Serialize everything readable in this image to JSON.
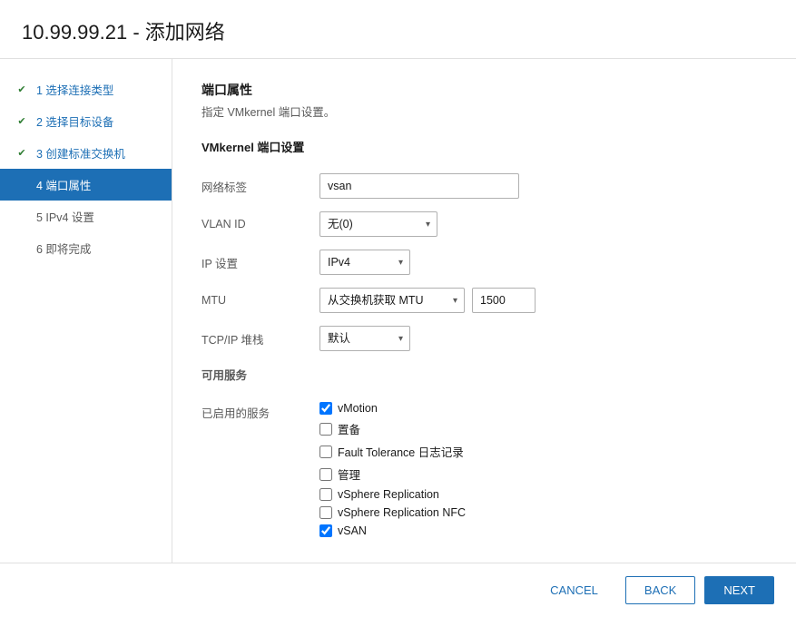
{
  "dialog": {
    "title": "10.99.99.21 - 添加网络"
  },
  "sidebar": {
    "items": [
      {
        "id": "step1",
        "label": "1 选择连接类型",
        "state": "completed"
      },
      {
        "id": "step2",
        "label": "2 选择目标设备",
        "state": "completed"
      },
      {
        "id": "step3",
        "label": "3 创建标准交换机",
        "state": "completed"
      },
      {
        "id": "step4",
        "label": "4 端口属性",
        "state": "active"
      },
      {
        "id": "step5",
        "label": "5 IPv4 设置",
        "state": "default"
      },
      {
        "id": "step6",
        "label": "6 即将完成",
        "state": "default"
      }
    ]
  },
  "main": {
    "section_title": "端口属性",
    "section_desc": "指定 VMkernel 端口设置。",
    "subsection_title": "VMkernel 端口设置",
    "fields": {
      "network_label": "网络标签",
      "network_label_value": "vsan",
      "vlan_id_label": "VLAN ID",
      "vlan_id_value": "无(0)",
      "ip_settings_label": "IP 设置",
      "ip_settings_value": "IPv4",
      "mtu_label": "MTU",
      "mtu_select_value": "从交换机获取 MTU",
      "mtu_input_value": "1500",
      "tcpip_label": "TCP/IP 堆栈",
      "tcpip_value": "默认"
    },
    "services": {
      "section_label": "可用服务",
      "enabled_label": "已启用的服务",
      "items": [
        {
          "id": "vmotion",
          "label": "vMotion",
          "checked": true
        },
        {
          "id": "provisioning",
          "label": "置备",
          "checked": false
        },
        {
          "id": "ft_logging",
          "label": "Fault Tolerance 日志记录",
          "checked": false
        },
        {
          "id": "management",
          "label": "管理",
          "checked": false
        },
        {
          "id": "vsphere_replication",
          "label": "vSphere Replication",
          "checked": false
        },
        {
          "id": "vsphere_replication_nfc",
          "label": "vSphere Replication NFC",
          "checked": false
        },
        {
          "id": "vsan",
          "label": "vSAN",
          "checked": true
        }
      ]
    }
  },
  "footer": {
    "cancel_label": "CANCEL",
    "back_label": "BACK",
    "next_label": "NEXT"
  }
}
